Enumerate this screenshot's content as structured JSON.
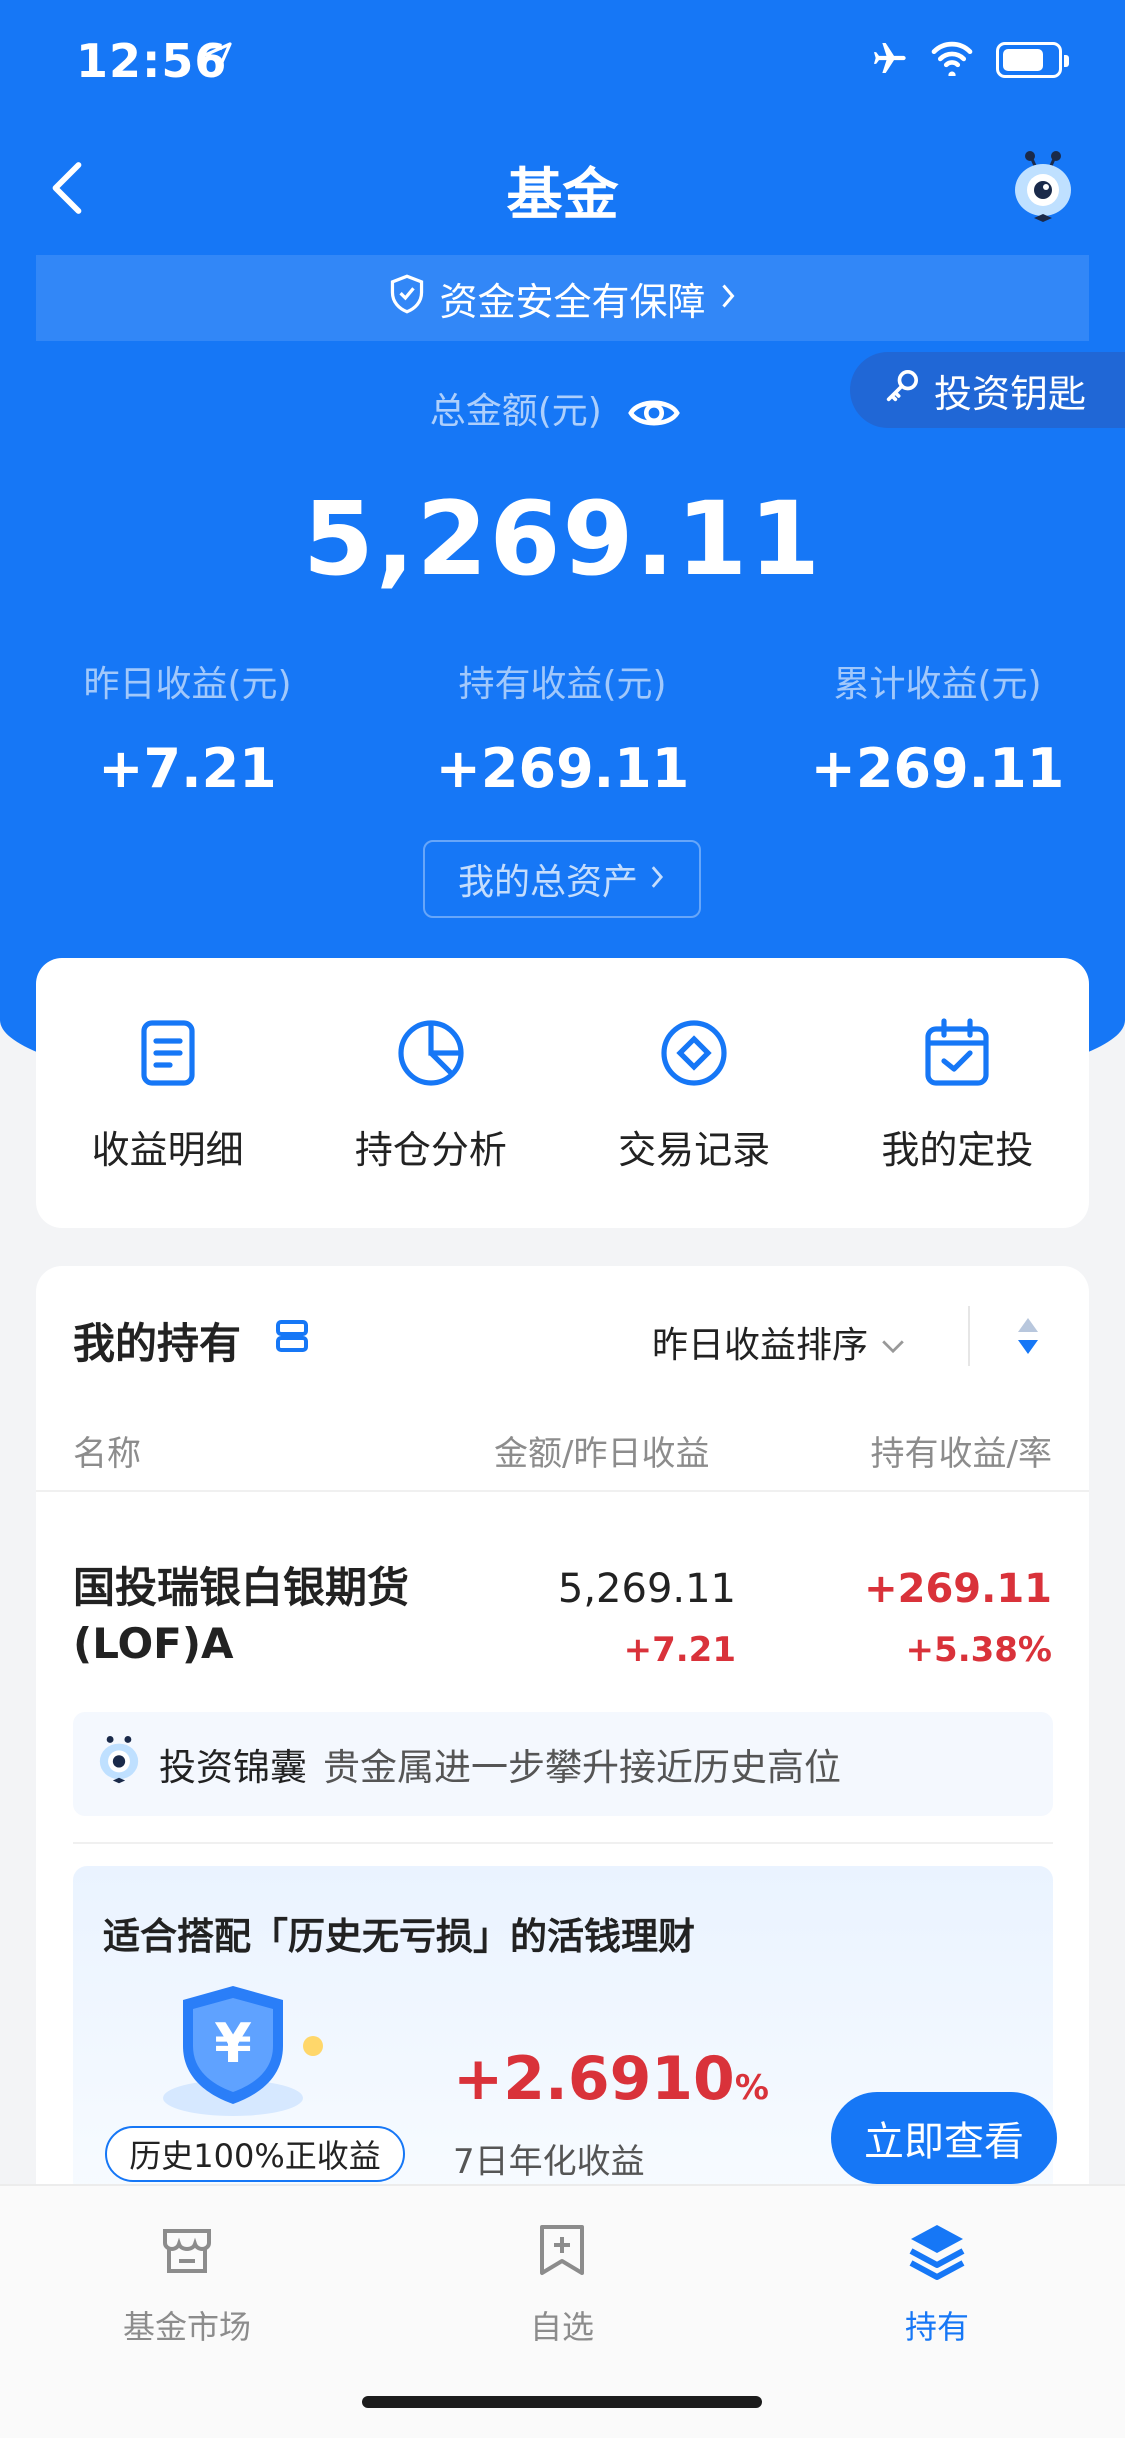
{
  "status_bar": {
    "time": "12:56"
  },
  "nav": {
    "title": "基金"
  },
  "banner": {
    "text": "资金安全有保障"
  },
  "key_pill": {
    "label": "投资钥匙"
  },
  "summary": {
    "total_label": "总金额(元)",
    "total_amount": "5,269.11",
    "stats": [
      {
        "label": "昨日收益(元)",
        "value": "+7.21"
      },
      {
        "label": "持有收益(元)",
        "value": "+269.11"
      },
      {
        "label": "累计收益(元)",
        "value": "+269.11"
      }
    ],
    "assets_button": "我的总资产"
  },
  "quick_actions": [
    {
      "label": "收益明细",
      "icon": "document-icon"
    },
    {
      "label": "持仓分析",
      "icon": "pie-chart-icon"
    },
    {
      "label": "交易记录",
      "icon": "compass-icon"
    },
    {
      "label": "我的定投",
      "icon": "calendar-check-icon"
    }
  ],
  "holdings": {
    "title": "我的持有",
    "sort_label": "昨日收益排序",
    "columns": [
      "名称",
      "金额/昨日收益",
      "持有收益/率"
    ],
    "fund": {
      "name": "国投瑞银白银期货(LOF)A",
      "amount": "5,269.11",
      "yesterday": "+7.21",
      "hold_profit": "+269.11",
      "hold_rate": "+5.38%"
    },
    "tip": {
      "tag": "投资锦囊",
      "text": "贵金属进一步攀升接近历史高位"
    },
    "promo": {
      "title": "适合搭配「历史无亏损」的活钱理财",
      "rate_value": "+2.6910",
      "rate_unit": "%",
      "rate_label": "7日年化收益",
      "badge": "历史100%正收益",
      "cta": "立即查看"
    }
  },
  "tabbar": [
    {
      "label": "基金市场",
      "active": false
    },
    {
      "label": "自选",
      "active": false
    },
    {
      "label": "持有",
      "active": true
    }
  ],
  "colors": {
    "brand": "#1677f6",
    "positive": "#d9323a"
  }
}
